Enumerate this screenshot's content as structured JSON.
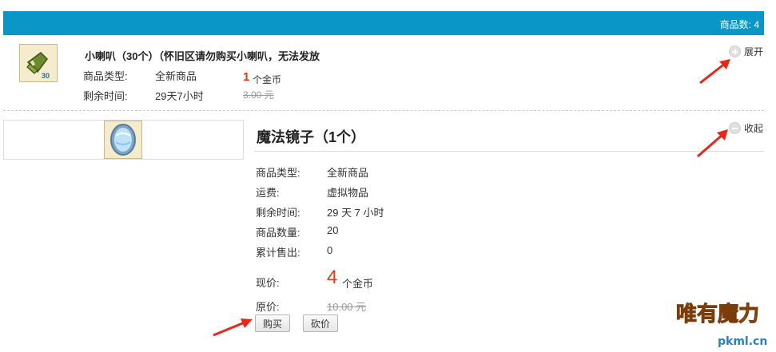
{
  "header": {
    "count_label": "商品数: 4"
  },
  "item1": {
    "title": "小喇叭（30个）（怀旧区请勿购买小喇叭，无法发放",
    "type_label": "商品类型:",
    "type_value": "全新商品",
    "time_label": "剩余时间:",
    "time_value": "29天7小时",
    "price_amount": "1",
    "price_unit": "个金币",
    "old_price": "3.00 元",
    "toggle_label": "展开",
    "thumb_badge": "30"
  },
  "item2": {
    "title": "魔法镜子（1个）",
    "toggle_label": "收起",
    "fields": [
      {
        "label": "商品类型:",
        "value": "全新商品"
      },
      {
        "label": "运费:",
        "value": "虚拟物品"
      },
      {
        "label": "剩余时间:",
        "value": "29 天 7 小时"
      },
      {
        "label": "商品数量:",
        "value": "20"
      },
      {
        "label": "累计售出:",
        "value": "0"
      }
    ],
    "current_price_label": "现价:",
    "price_amount": "4",
    "price_unit": "个金币",
    "original_price_label": "原价:",
    "old_price": "10.00 元",
    "buy_label": "购买",
    "bargain_label": "砍价"
  },
  "watermark": {
    "text": "唯有魔力",
    "url": "pkml.cn"
  },
  "colors": {
    "header_bg": "#0a97c8",
    "price_red": "#e8380d",
    "arrow_red": "#e8261c"
  }
}
